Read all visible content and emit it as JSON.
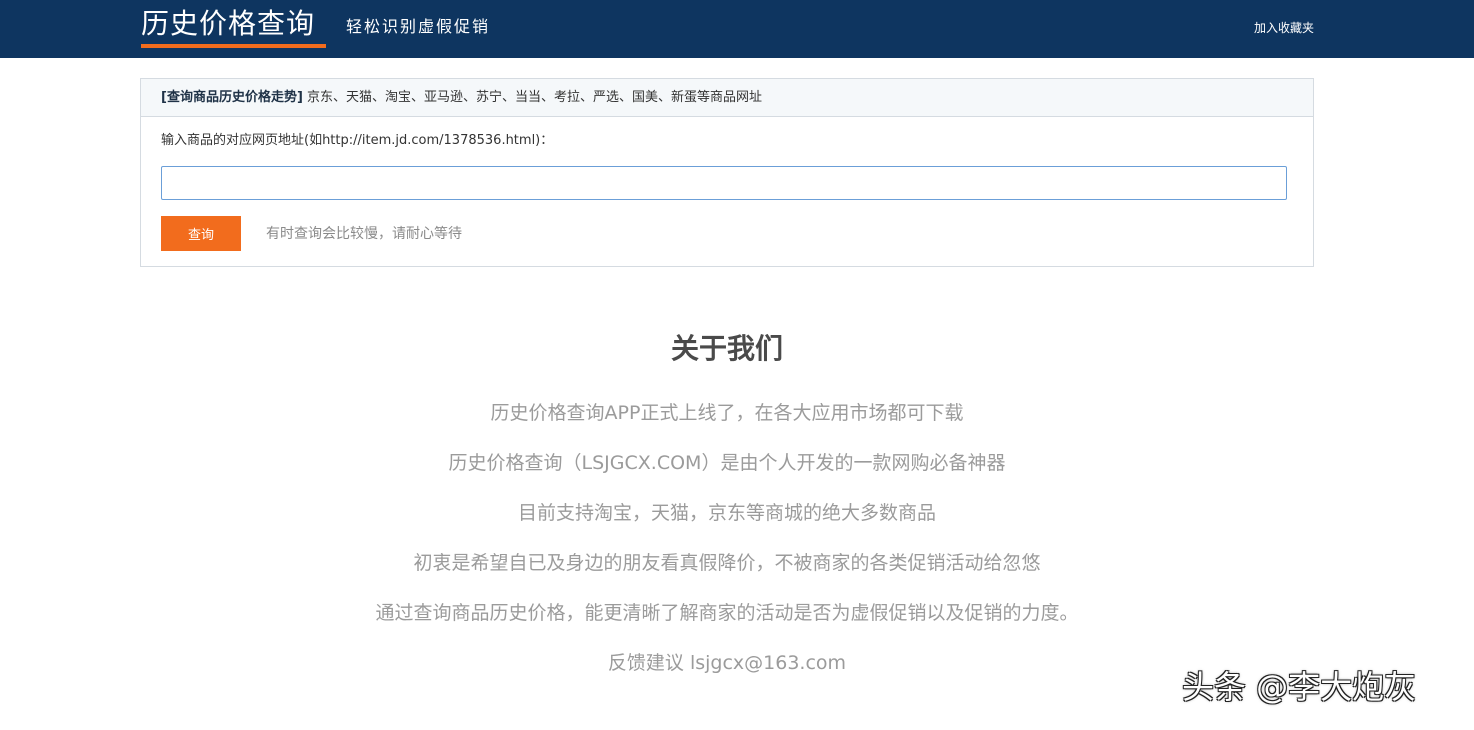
{
  "header": {
    "logo": "历史价格查询",
    "slogan": "轻松识别虚假促销",
    "bookmark": "加入收藏夹"
  },
  "query_panel": {
    "title_bold": "[查询商品历史价格走势]",
    "title_sites": " 京东、天猫、淘宝、亚马逊、苏宁、当当、考拉、严选、国美、新蛋等商品网址",
    "input_label": "输入商品的对应网页地址(如http://item.jd.com/1378536.html)：",
    "input_value": "",
    "button_label": "查询",
    "wait_hint": "有时查询会比较慢，请耐心等待"
  },
  "about": {
    "title": "关于我们",
    "lines": [
      "历史价格查询APP正式上线了，在各大应用市场都可下载",
      "历史价格查询（LSJGCX.COM）是由个人开发的一款网购必备神器",
      "目前支持淘宝，天猫，京东等商城的绝大多数商品",
      "初衷是希望自已及身边的朋友看真假降价，不被商家的各类促销活动给忽悠",
      "通过查询商品历史价格，能更清晰了解商家的活动是否为虚假促销以及促销的力度。",
      "反馈建议 lsjgcx@163.com"
    ]
  },
  "watermark": "头条 @李大炮灰",
  "colors": {
    "header_bg": "#0e3560",
    "accent": "#f26c1d"
  }
}
